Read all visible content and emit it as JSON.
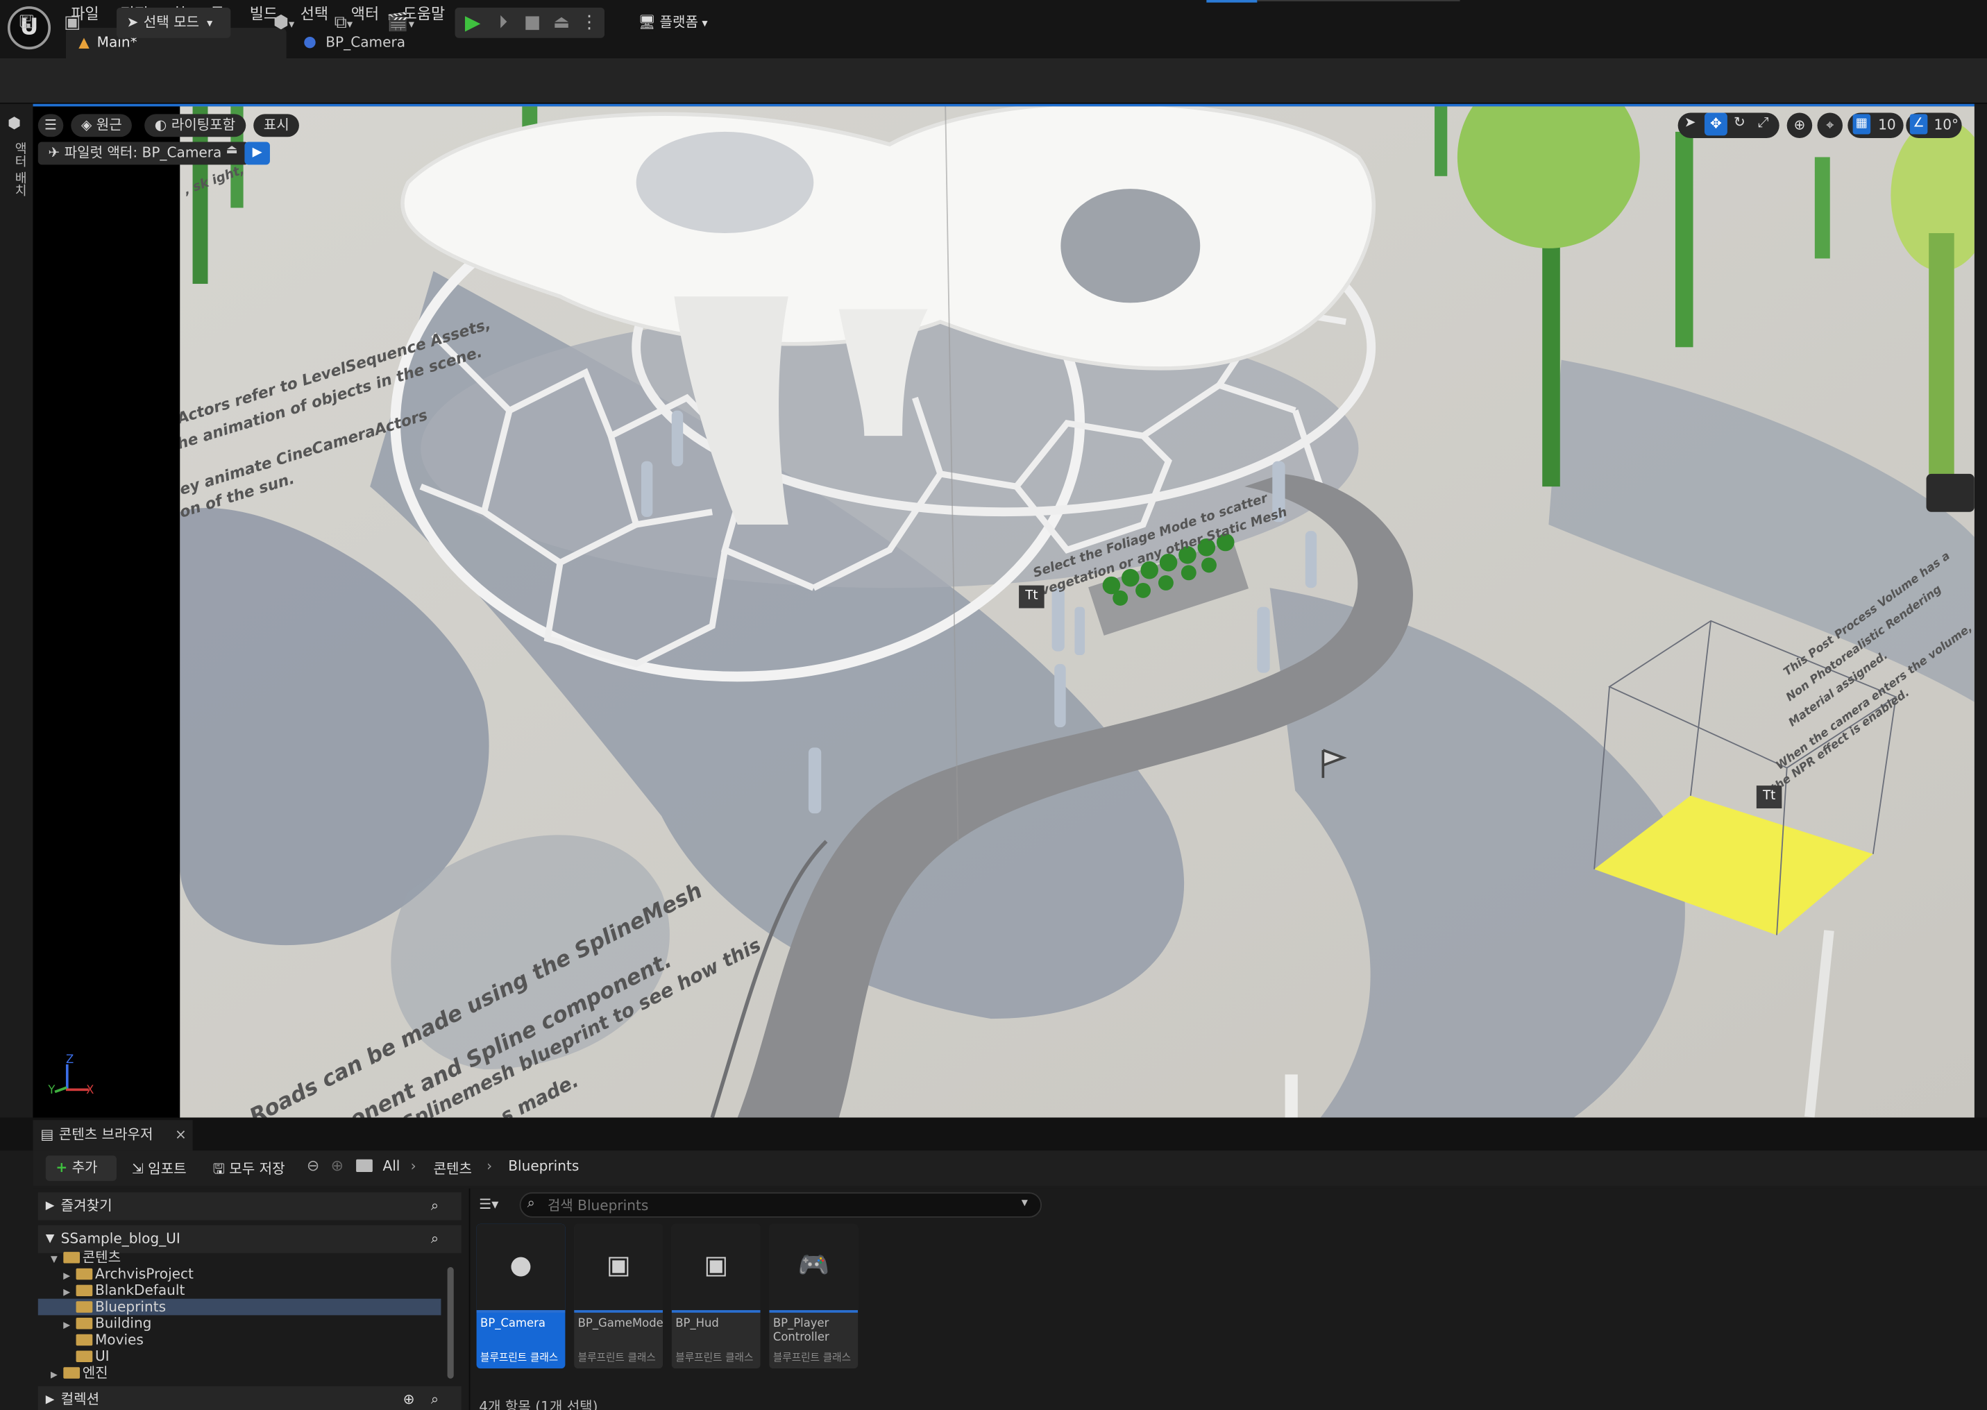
{
  "menu": {
    "items": [
      "파일",
      "편집",
      "창",
      "툴",
      "빌드",
      "선택",
      "액터",
      "도움말"
    ]
  },
  "tabs": [
    {
      "label": "Main*"
    },
    {
      "label": "BP_Camera"
    }
  ],
  "toolbar": {
    "mode_label": "선택 모드",
    "platform_label": "플랫폼"
  },
  "side_strip": {
    "label": "액터 배치"
  },
  "viewport": {
    "perspective_label": "원근",
    "lighting_label": "라이팅포함",
    "show_label": "표시",
    "pilot_label": "파일럿 액터: BP_Camera",
    "grid_value": "10",
    "angle_value": "10°",
    "scene_texts": [
      "Actors refer to LevelSequence Assets,",
      "he animation of objects in the scene.",
      "ey animate CineCameraActors",
      "on of the sun.",
      "Select the Foliage Mode to scatter",
      "vegetation or any other Static Mesh",
      "This Post Process Volume has a",
      "Non Photorealistic Rendering",
      "Material assigned.",
      "When the camera enters the volume,",
      "the NPR effect is enabled.",
      "Roads can be made using the SplineMesh",
      "ponent and Spline component.",
      "Splinemesh blueprint to see how this",
      "s made.",
      ", sk   ight,"
    ],
    "axis_labels": {
      "z": "Z",
      "y": "Y",
      "x": "X"
    }
  },
  "content_browser": {
    "tab_label": "콘텐츠 브라우저",
    "add_label": "추가",
    "import_label": "임포트",
    "save_all_label": "모두 저장",
    "breadcrumb": [
      "All",
      "콘텐츠",
      "Blueprints"
    ],
    "favorites_label": "즐겨찾기",
    "project_label": "SSample_blog_UI",
    "collections_label": "컬렉션",
    "tree": [
      {
        "label": "콘텐츠",
        "depth": 1,
        "expanded": true
      },
      {
        "label": "ArchvisProject",
        "depth": 2,
        "arrow": true
      },
      {
        "label": "BlankDefault",
        "depth": 2,
        "arrow": true
      },
      {
        "label": "Blueprints",
        "depth": 2,
        "arrow": false,
        "selected": true
      },
      {
        "label": "Building",
        "depth": 2,
        "arrow": true
      },
      {
        "label": "Movies",
        "depth": 2,
        "arrow": false
      },
      {
        "label": "UI",
        "depth": 2,
        "arrow": false
      },
      {
        "label": "엔진",
        "depth": 1,
        "arrow": true
      }
    ],
    "search_placeholder": "검색 Blueprints",
    "assets": [
      {
        "name": "BP_Camera",
        "type": "블루프린트 클래스",
        "selected": true,
        "icon": "camera-sphere-icon"
      },
      {
        "name": "BP_GameMode",
        "type": "블루프린트 클래스",
        "selected": false,
        "icon": "game-mode-icon"
      },
      {
        "name": "BP_Hud",
        "type": "블루프린트 클래스",
        "selected": false,
        "icon": "hud-icon"
      },
      {
        "name": "BP_Player Controller",
        "type": "블루프린트 클래스",
        "selected": false,
        "icon": "gamepad-icon"
      }
    ],
    "status": "4개 항목 (1개 선택)"
  },
  "colors": {
    "accent": "#1f6fd1",
    "selection": "#1668d6",
    "folder": "#c9a04a",
    "play_green": "#3fc13f",
    "ppv_yellow": "#f2ee4e"
  }
}
